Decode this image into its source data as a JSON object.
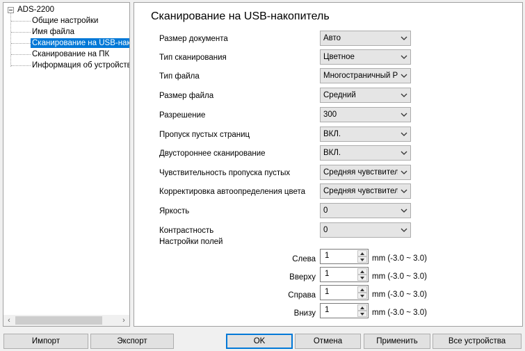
{
  "tree": {
    "root": "ADS-2200",
    "items": [
      {
        "label": "Общие настройки",
        "selected": false
      },
      {
        "label": "Имя файла",
        "selected": false
      },
      {
        "label": "Сканирование на USB-накопитель",
        "selected": true
      },
      {
        "label": "Сканирование на ПК",
        "selected": false
      },
      {
        "label": "Информация об устройстве",
        "selected": false
      }
    ],
    "scroll_left": "‹",
    "scroll_right": "›"
  },
  "panel": {
    "title": "Сканирование на USB-накопитель",
    "fields": [
      {
        "label": "Размер документа",
        "value": "Авто"
      },
      {
        "label": "Тип сканирования",
        "value": "Цветное"
      },
      {
        "label": "Тип файла",
        "value": "Многостраничный PDF"
      },
      {
        "label": "Размер файла",
        "value": "Средний"
      },
      {
        "label": "Разрешение",
        "value": "300"
      },
      {
        "label": "Пропуск пустых страниц",
        "value": "ВКЛ."
      },
      {
        "label": "Двустороннее сканирование",
        "value": "ВКЛ."
      },
      {
        "label": "Чувствительность пропуска пустых",
        "value": "Средняя чувствительность"
      },
      {
        "label": "Корректировка автоопределения цвета",
        "value": "Средняя чувствительность"
      },
      {
        "label": "Яркость",
        "value": "0"
      },
      {
        "label": "Контрастность",
        "value": "0"
      }
    ],
    "margins": {
      "title": "Настройки полей",
      "items": [
        {
          "label": "Слева",
          "value": "1",
          "range": "mm (-3.0 ~ 3.0)"
        },
        {
          "label": "Вверху",
          "value": "1",
          "range": "mm (-3.0 ~ 3.0)"
        },
        {
          "label": "Справа",
          "value": "1",
          "range": "mm (-3.0 ~ 3.0)"
        },
        {
          "label": "Внизу",
          "value": "1",
          "range": "mm (-3.0 ~ 3.0)"
        }
      ]
    }
  },
  "footer": {
    "import": "Импорт",
    "export": "Экспорт",
    "ok": "OK",
    "cancel": "Отмена",
    "apply": "Применить",
    "all_devices": "Все устройства"
  },
  "icons": {
    "dropdown": "chevron-down-icon",
    "spin_up": "spin-up-icon",
    "spin_down": "spin-down-icon",
    "collapse": "tree-collapse-icon"
  },
  "colors": {
    "selection": "#0078d7",
    "combo_bg": "#e5e5e5",
    "window_bg": "#f0f0f0"
  }
}
